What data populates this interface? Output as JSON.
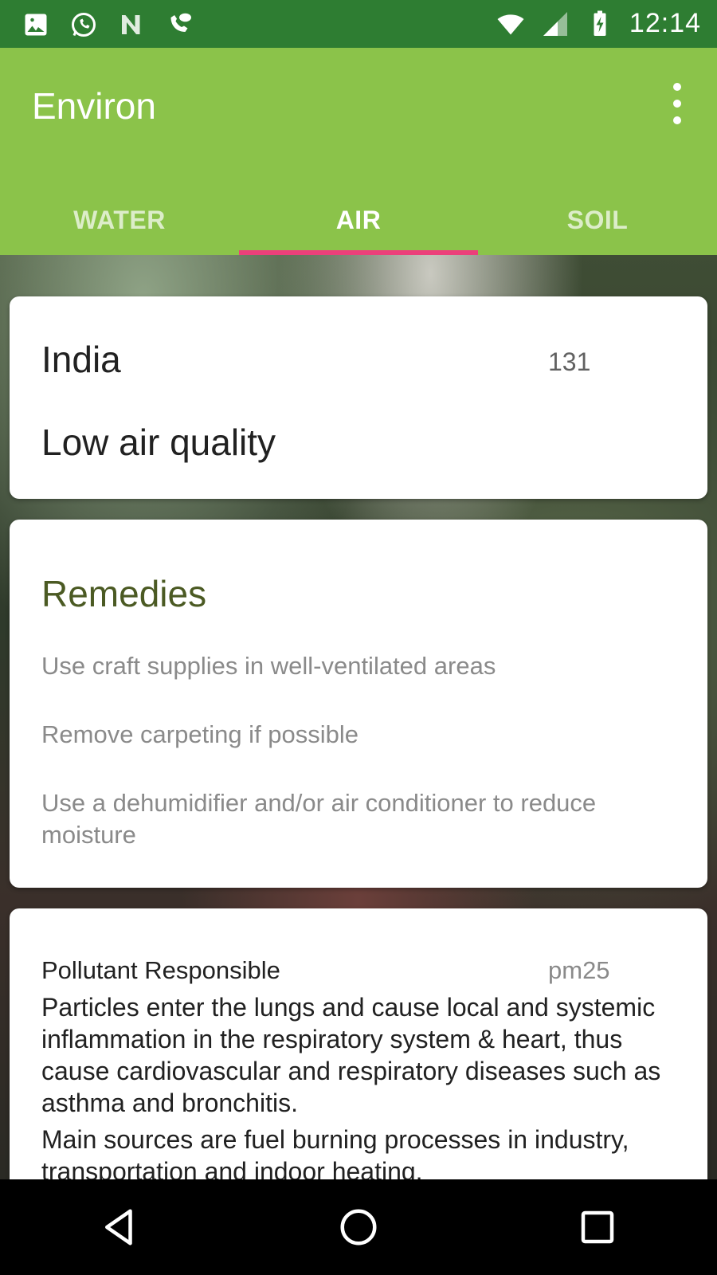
{
  "status_bar": {
    "time": "12:14",
    "left_icons": [
      "image-icon",
      "whatsapp-icon",
      "n-icon",
      "voicemail-chat-icon"
    ],
    "right_icons": [
      "wifi-icon",
      "signal-icon",
      "battery-charging-icon"
    ]
  },
  "app_bar": {
    "title": "Environ",
    "color": "#8bc34a",
    "status_color": "#2e7d32"
  },
  "tabs": [
    {
      "label": "WATER",
      "active": false
    },
    {
      "label": "AIR",
      "active": true
    },
    {
      "label": "SOIL",
      "active": false
    }
  ],
  "indicator_color": "#ec407a",
  "location_card": {
    "country": "India",
    "value": "131",
    "quality": "Low air quality"
  },
  "remedies_card": {
    "title": "Remedies",
    "items": [
      "Use craft supplies in well-ventilated areas",
      "Remove carpeting if possible",
      "Use a dehumidifier and/or air conditioner to reduce moisture"
    ]
  },
  "pollutant_card": {
    "label": "Pollutant Responsible",
    "value": "pm25",
    "paragraphs": [
      "Particles enter the lungs and cause local and systemic inflammation in the respiratory system & heart, thus cause cardiovascular and respiratory diseases such as asthma and bronchitis.",
      "Main sources are fuel burning processes in industry, transportation and indoor heating."
    ]
  },
  "nav_bar": {
    "buttons": [
      "back-icon",
      "home-icon",
      "recents-icon"
    ]
  }
}
